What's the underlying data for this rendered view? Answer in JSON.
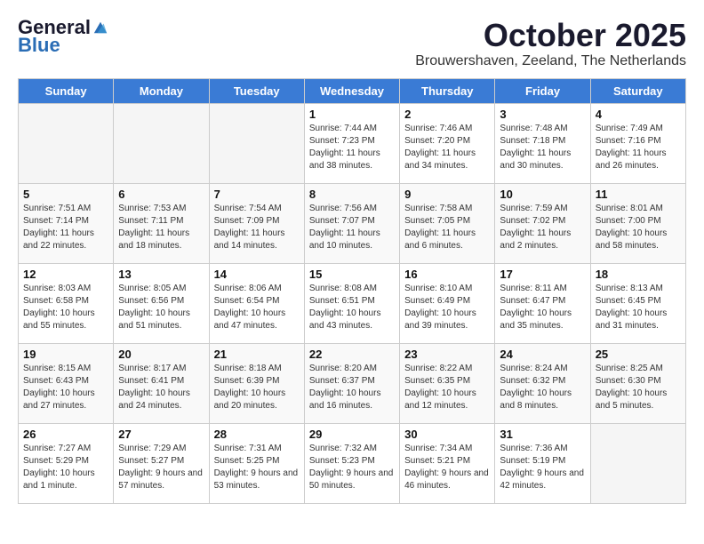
{
  "header": {
    "logo_general": "General",
    "logo_blue": "Blue",
    "month_title": "October 2025",
    "location": "Brouwershaven, Zeeland, The Netherlands"
  },
  "days_of_week": [
    "Sunday",
    "Monday",
    "Tuesday",
    "Wednesday",
    "Thursday",
    "Friday",
    "Saturday"
  ],
  "weeks": [
    [
      {
        "day": "",
        "empty": true
      },
      {
        "day": "",
        "empty": true
      },
      {
        "day": "",
        "empty": true
      },
      {
        "day": "1",
        "sunrise": "7:44 AM",
        "sunset": "7:23 PM",
        "daylight": "11 hours and 38 minutes."
      },
      {
        "day": "2",
        "sunrise": "7:46 AM",
        "sunset": "7:20 PM",
        "daylight": "11 hours and 34 minutes."
      },
      {
        "day": "3",
        "sunrise": "7:48 AM",
        "sunset": "7:18 PM",
        "daylight": "11 hours and 30 minutes."
      },
      {
        "day": "4",
        "sunrise": "7:49 AM",
        "sunset": "7:16 PM",
        "daylight": "11 hours and 26 minutes."
      }
    ],
    [
      {
        "day": "5",
        "sunrise": "7:51 AM",
        "sunset": "7:14 PM",
        "daylight": "11 hours and 22 minutes."
      },
      {
        "day": "6",
        "sunrise": "7:53 AM",
        "sunset": "7:11 PM",
        "daylight": "11 hours and 18 minutes."
      },
      {
        "day": "7",
        "sunrise": "7:54 AM",
        "sunset": "7:09 PM",
        "daylight": "11 hours and 14 minutes."
      },
      {
        "day": "8",
        "sunrise": "7:56 AM",
        "sunset": "7:07 PM",
        "daylight": "11 hours and 10 minutes."
      },
      {
        "day": "9",
        "sunrise": "7:58 AM",
        "sunset": "7:05 PM",
        "daylight": "11 hours and 6 minutes."
      },
      {
        "day": "10",
        "sunrise": "7:59 AM",
        "sunset": "7:02 PM",
        "daylight": "11 hours and 2 minutes."
      },
      {
        "day": "11",
        "sunrise": "8:01 AM",
        "sunset": "7:00 PM",
        "daylight": "10 hours and 58 minutes."
      }
    ],
    [
      {
        "day": "12",
        "sunrise": "8:03 AM",
        "sunset": "6:58 PM",
        "daylight": "10 hours and 55 minutes."
      },
      {
        "day": "13",
        "sunrise": "8:05 AM",
        "sunset": "6:56 PM",
        "daylight": "10 hours and 51 minutes."
      },
      {
        "day": "14",
        "sunrise": "8:06 AM",
        "sunset": "6:54 PM",
        "daylight": "10 hours and 47 minutes."
      },
      {
        "day": "15",
        "sunrise": "8:08 AM",
        "sunset": "6:51 PM",
        "daylight": "10 hours and 43 minutes."
      },
      {
        "day": "16",
        "sunrise": "8:10 AM",
        "sunset": "6:49 PM",
        "daylight": "10 hours and 39 minutes."
      },
      {
        "day": "17",
        "sunrise": "8:11 AM",
        "sunset": "6:47 PM",
        "daylight": "10 hours and 35 minutes."
      },
      {
        "day": "18",
        "sunrise": "8:13 AM",
        "sunset": "6:45 PM",
        "daylight": "10 hours and 31 minutes."
      }
    ],
    [
      {
        "day": "19",
        "sunrise": "8:15 AM",
        "sunset": "6:43 PM",
        "daylight": "10 hours and 27 minutes."
      },
      {
        "day": "20",
        "sunrise": "8:17 AM",
        "sunset": "6:41 PM",
        "daylight": "10 hours and 24 minutes."
      },
      {
        "day": "21",
        "sunrise": "8:18 AM",
        "sunset": "6:39 PM",
        "daylight": "10 hours and 20 minutes."
      },
      {
        "day": "22",
        "sunrise": "8:20 AM",
        "sunset": "6:37 PM",
        "daylight": "10 hours and 16 minutes."
      },
      {
        "day": "23",
        "sunrise": "8:22 AM",
        "sunset": "6:35 PM",
        "daylight": "10 hours and 12 minutes."
      },
      {
        "day": "24",
        "sunrise": "8:24 AM",
        "sunset": "6:32 PM",
        "daylight": "10 hours and 8 minutes."
      },
      {
        "day": "25",
        "sunrise": "8:25 AM",
        "sunset": "6:30 PM",
        "daylight": "10 hours and 5 minutes."
      }
    ],
    [
      {
        "day": "26",
        "sunrise": "7:27 AM",
        "sunset": "5:29 PM",
        "daylight": "10 hours and 1 minute."
      },
      {
        "day": "27",
        "sunrise": "7:29 AM",
        "sunset": "5:27 PM",
        "daylight": "9 hours and 57 minutes."
      },
      {
        "day": "28",
        "sunrise": "7:31 AM",
        "sunset": "5:25 PM",
        "daylight": "9 hours and 53 minutes."
      },
      {
        "day": "29",
        "sunrise": "7:32 AM",
        "sunset": "5:23 PM",
        "daylight": "9 hours and 50 minutes."
      },
      {
        "day": "30",
        "sunrise": "7:34 AM",
        "sunset": "5:21 PM",
        "daylight": "9 hours and 46 minutes."
      },
      {
        "day": "31",
        "sunrise": "7:36 AM",
        "sunset": "5:19 PM",
        "daylight": "9 hours and 42 minutes."
      },
      {
        "day": "",
        "empty": true
      }
    ]
  ],
  "labels": {
    "sunrise_label": "Sunrise:",
    "sunset_label": "Sunset:",
    "daylight_label": "Daylight:"
  }
}
